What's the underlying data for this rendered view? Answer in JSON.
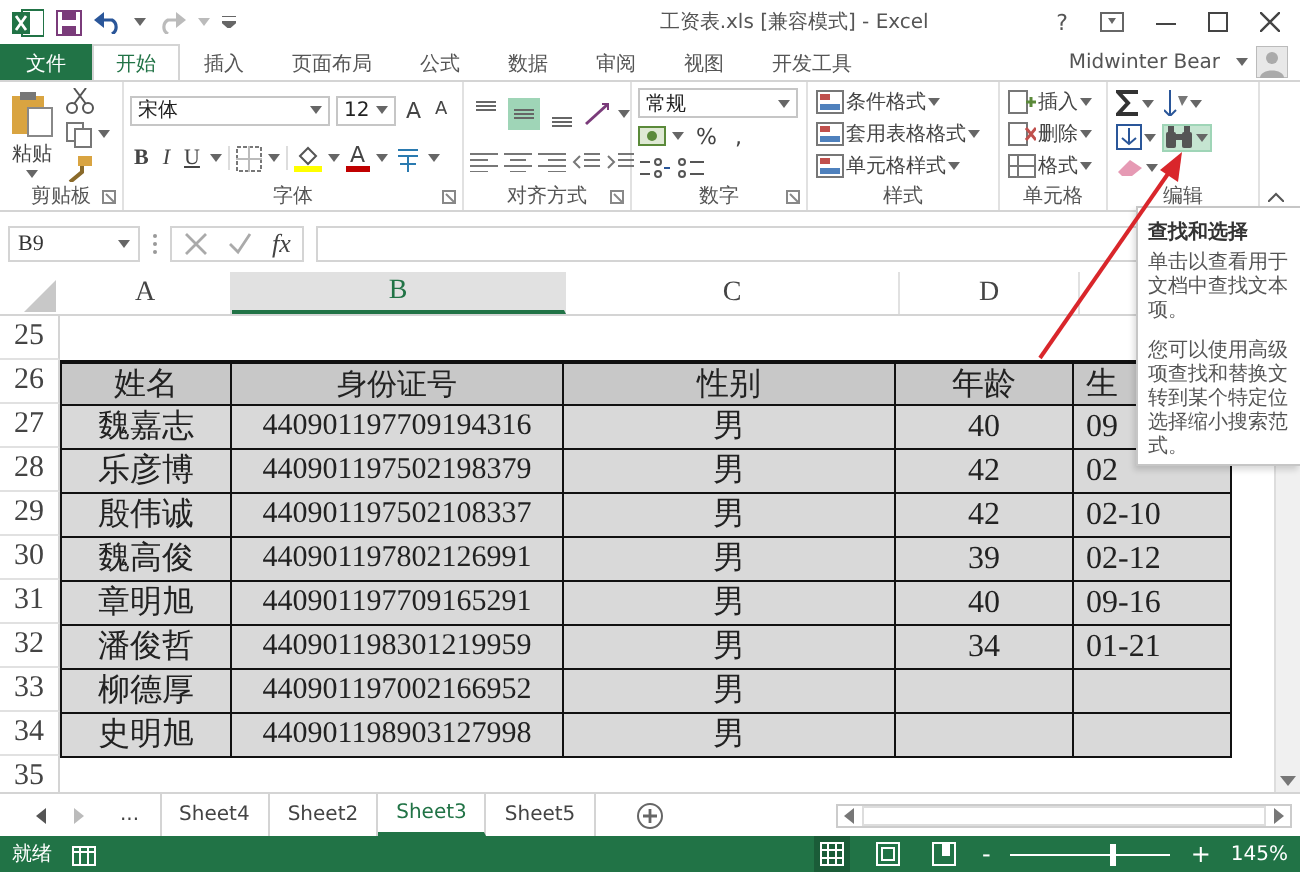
{
  "title_bar": {
    "title": "工资表.xls  [兼容模式] - Excel",
    "help": "?"
  },
  "ribbon_tabs": [
    {
      "label": "文件",
      "kind": "file",
      "selected": false
    },
    {
      "label": "开始",
      "kind": "tab",
      "selected": true
    },
    {
      "label": "插入",
      "kind": "tab",
      "selected": false
    },
    {
      "label": "页面布局",
      "kind": "tab",
      "selected": false
    },
    {
      "label": "公式",
      "kind": "tab",
      "selected": false
    },
    {
      "label": "数据",
      "kind": "tab",
      "selected": false
    },
    {
      "label": "审阅",
      "kind": "tab",
      "selected": false
    },
    {
      "label": "视图",
      "kind": "tab",
      "selected": false
    },
    {
      "label": "开发工具",
      "kind": "tab",
      "selected": false
    }
  ],
  "user": {
    "name": "Midwinter Bear"
  },
  "ribbon_groups": [
    {
      "kind": "clipboard",
      "label": "剪贴板",
      "paste": "粘贴"
    },
    {
      "kind": "font",
      "label": "字体",
      "font_name": "宋体",
      "font_size": "12",
      "size_buttons": [
        "A",
        "A"
      ],
      "styles": [
        "B",
        "I",
        "U"
      ],
      "font_color": "A"
    },
    {
      "kind": "alignment",
      "label": "对齐方式",
      "vertical_buttons": [
        {
          "selected": false
        },
        {
          "selected": true
        },
        {
          "selected": false
        }
      ]
    },
    {
      "kind": "number",
      "label": "数字",
      "format": "常规",
      "percent": "%",
      "comma": ","
    },
    {
      "kind": "styles",
      "label": "样式",
      "commands": [
        "条件格式",
        "套用表格格式",
        "单元格样式"
      ]
    },
    {
      "kind": "cells",
      "label": "单元格",
      "commands": [
        "插入",
        "删除",
        "格式"
      ]
    },
    {
      "kind": "editing",
      "label": "编辑",
      "find_hovered": true
    }
  ],
  "formula_bar": {
    "name_box": "B9",
    "fx": "fx"
  },
  "columns": [
    {
      "label": "A",
      "selected": false
    },
    {
      "label": "B",
      "selected": true
    },
    {
      "label": "C",
      "selected": false
    },
    {
      "label": "D",
      "selected": false
    }
  ],
  "rows": [
    {
      "number": "25",
      "kind": "blank"
    },
    {
      "number": "26",
      "kind": "header",
      "cells": [
        "姓名",
        "身份证号",
        "性别",
        "年龄",
        "生"
      ]
    },
    {
      "number": "27",
      "kind": "data",
      "cells": [
        "魏嘉志",
        "440901197709194316",
        "男",
        "40",
        "09"
      ]
    },
    {
      "number": "28",
      "kind": "data",
      "cells": [
        "乐彦博",
        "440901197502198379",
        "男",
        "42",
        "02"
      ]
    },
    {
      "number": "29",
      "kind": "data",
      "cells": [
        "殷伟诚",
        "440901197502108337",
        "男",
        "42",
        "02-10"
      ]
    },
    {
      "number": "30",
      "kind": "data",
      "cells": [
        "魏高俊",
        "440901197802126991",
        "男",
        "39",
        "02-12"
      ]
    },
    {
      "number": "31",
      "kind": "data",
      "cells": [
        "章明旭",
        "440901197709165291",
        "男",
        "40",
        "09-16"
      ]
    },
    {
      "number": "32",
      "kind": "data",
      "cells": [
        "潘俊哲",
        "440901198301219959",
        "男",
        "34",
        "01-21"
      ]
    },
    {
      "number": "33",
      "kind": "data",
      "cells": [
        "柳德厚",
        "440901197002166952",
        "男"
      ]
    },
    {
      "number": "34",
      "kind": "data",
      "cells": [
        "史明旭",
        "440901198903127998",
        "男"
      ]
    },
    {
      "number": "35",
      "kind": "blank"
    }
  ],
  "tooltip": {
    "title": "查找和选择",
    "paragraphs": [
      [
        "单击以查看用于",
        "文档中查找文本",
        "项。"
      ],
      [
        "您可以使用高级",
        "项查找和替换文",
        "转到某个特定位",
        "选择缩小搜索范",
        "式。"
      ]
    ]
  },
  "sheet_tabs": [
    {
      "label": "...",
      "kind": "more",
      "selected": false
    },
    {
      "label": "Sheet4",
      "kind": "sheet",
      "selected": false
    },
    {
      "label": "Sheet2",
      "kind": "sheet",
      "selected": false
    },
    {
      "label": "Sheet3",
      "kind": "sheet",
      "selected": true
    },
    {
      "label": "Sheet5",
      "kind": "sheet",
      "selected": false
    }
  ],
  "status_bar": {
    "status": "就绪",
    "zoom_minus": "-",
    "zoom_plus": "+",
    "zoom": "145%",
    "zoom_slider": {
      "level": 0.63
    },
    "views": [
      {
        "selected": true
      },
      {
        "selected": false
      },
      {
        "selected": false
      }
    ]
  }
}
